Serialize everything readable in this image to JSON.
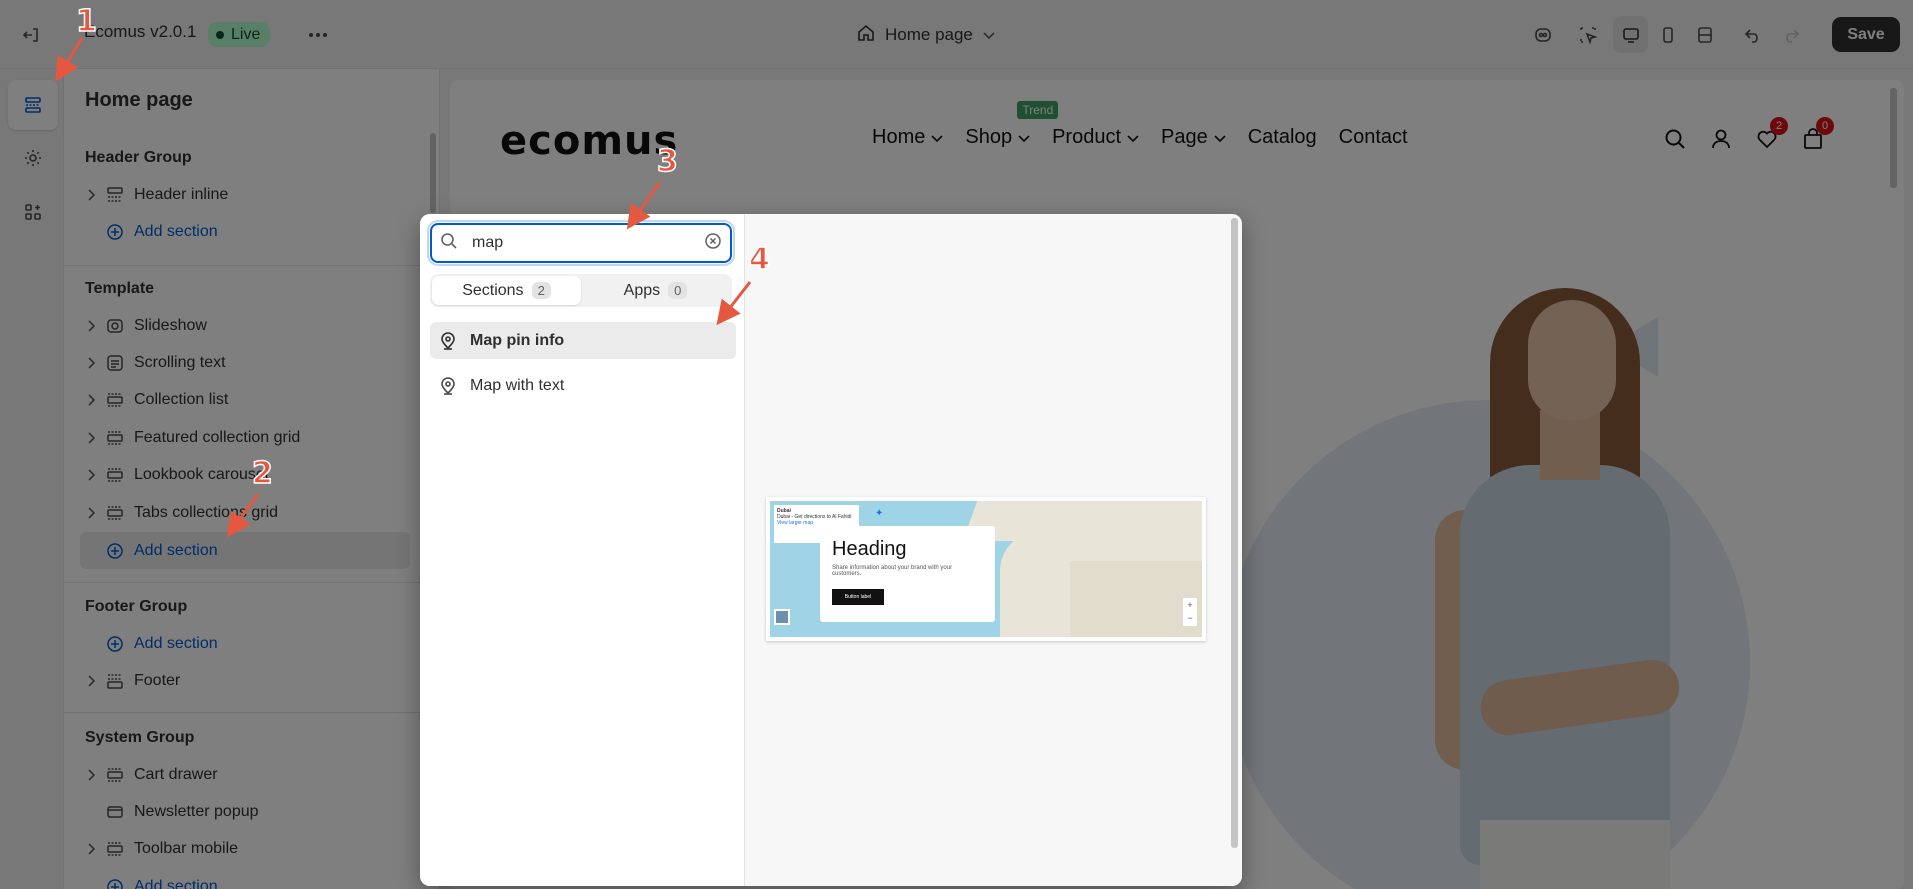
{
  "topbar": {
    "app_name": "Ecomus v2.0.1",
    "status_badge": "Live",
    "page_selector": "Home page",
    "save_label": "Save"
  },
  "sidebar": {
    "title": "Home page",
    "header_group": {
      "title": "Header Group",
      "items": [
        {
          "label": "Header inline"
        }
      ],
      "add_label": "Add section"
    },
    "template": {
      "title": "Template",
      "items": [
        {
          "label": "Slideshow"
        },
        {
          "label": "Scrolling text"
        },
        {
          "label": "Collection list"
        },
        {
          "label": "Featured collection grid"
        },
        {
          "label": "Lookbook carousel"
        },
        {
          "label": "Tabs collections grid"
        }
      ],
      "add_label": "Add section"
    },
    "footer_group": {
      "title": "Footer Group",
      "add_label": "Add section",
      "items": [
        {
          "label": "Footer"
        }
      ]
    },
    "system_group": {
      "title": "System Group",
      "items": [
        {
          "label": "Cart drawer"
        },
        {
          "label": "Newsletter popup"
        },
        {
          "label": "Toolbar mobile"
        }
      ],
      "add_label": "Add section"
    }
  },
  "picker": {
    "search_value": "map",
    "tabs": [
      {
        "label": "Sections",
        "count": "2"
      },
      {
        "label": "Apps",
        "count": "0"
      }
    ],
    "results": [
      {
        "label": "Map pin info"
      },
      {
        "label": "Map with text"
      }
    ],
    "preview": {
      "heading": "Heading",
      "body": "Share information about your brand with your customers.",
      "button": "Button label",
      "info_title": "Dubai",
      "info_text": "Dubai - Get directions to Al Fahidi",
      "info_link": "View larger map",
      "zoom_in": "+",
      "zoom_out": "−"
    }
  },
  "store_preview": {
    "logo": "ecomus",
    "nav": [
      {
        "label": "Home"
      },
      {
        "label": "Shop",
        "tag": "Trend"
      },
      {
        "label": "Product"
      },
      {
        "label": "Page"
      },
      {
        "label": "Catalog"
      },
      {
        "label": "Contact"
      }
    ],
    "wishlist_count": "2",
    "cart_count": "0"
  },
  "annotations": [
    "1",
    "2",
    "3",
    "4"
  ],
  "colors": {
    "accent": "#005bd3",
    "live_badge": "#b4fed2",
    "trend_tag": "#3fa163",
    "annotation": "#e5583f"
  }
}
